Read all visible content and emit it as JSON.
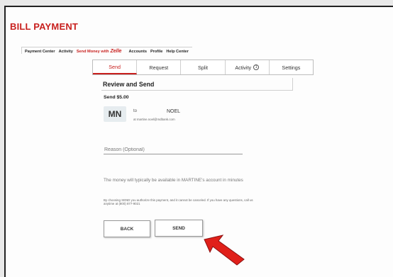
{
  "app": {
    "title": "BILL PAYMENT"
  },
  "top_nav": {
    "items": [
      "Payment Center",
      "Activity",
      "Send Money with",
      "Accounts",
      "Profile",
      "Help Center"
    ],
    "zelle_brand": "Zelle",
    "active_index": 2
  },
  "tabs": {
    "items": [
      "Send",
      "Request",
      "Split",
      "Activity",
      "Settings"
    ],
    "activity_badge": "1",
    "active_index": 0
  },
  "review": {
    "title": "Review and Send",
    "amount": "Send $5.00"
  },
  "recipient": {
    "initials": "MN",
    "to_label": "to",
    "name": "NOEL",
    "email": "at martine.noel@mdbank.com"
  },
  "reason": {
    "placeholder": "Reason (Optional)"
  },
  "availability_text": "The money will typically be available in MARTINE's account in minutes",
  "disclaimer": {
    "line1": "By choosing SEND you authorize this payment, and it cannot be canceled. If you have any questions, call us",
    "line2": "anytime at (800) 877-9021"
  },
  "buttons": {
    "back": "BACK",
    "send": "SEND"
  },
  "colors": {
    "brand_red": "#c8201e",
    "arrow_red": "#e0201a"
  }
}
